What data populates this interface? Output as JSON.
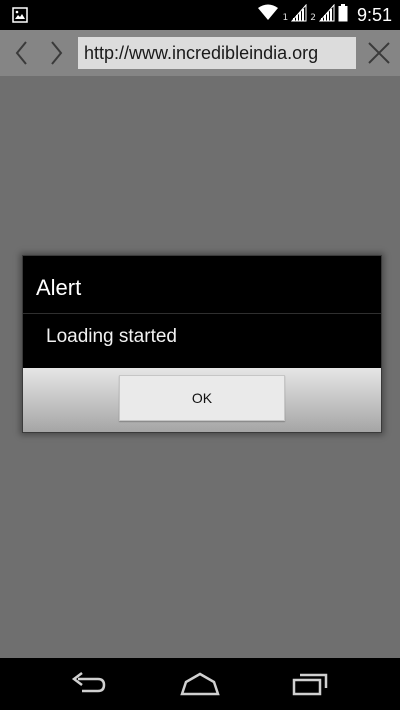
{
  "status_bar": {
    "sim1": "1",
    "sim2": "2",
    "time": "9:51",
    "icons": [
      "image-notification-icon",
      "wifi-icon",
      "signal-icon",
      "signal-icon",
      "battery-icon"
    ]
  },
  "browser": {
    "url": "http://www.incredibleindia.org",
    "icons": [
      "chevron-left-icon",
      "chevron-right-icon",
      "close-icon"
    ]
  },
  "dialog": {
    "title": "Alert",
    "message": "Loading started",
    "ok_label": "OK"
  },
  "nav_bar": {
    "icons": [
      "back-icon",
      "home-icon",
      "recent-apps-icon"
    ]
  },
  "colors": {
    "background": "#6f6f6f",
    "toolbar": "#858585",
    "dialog": "#000000"
  }
}
